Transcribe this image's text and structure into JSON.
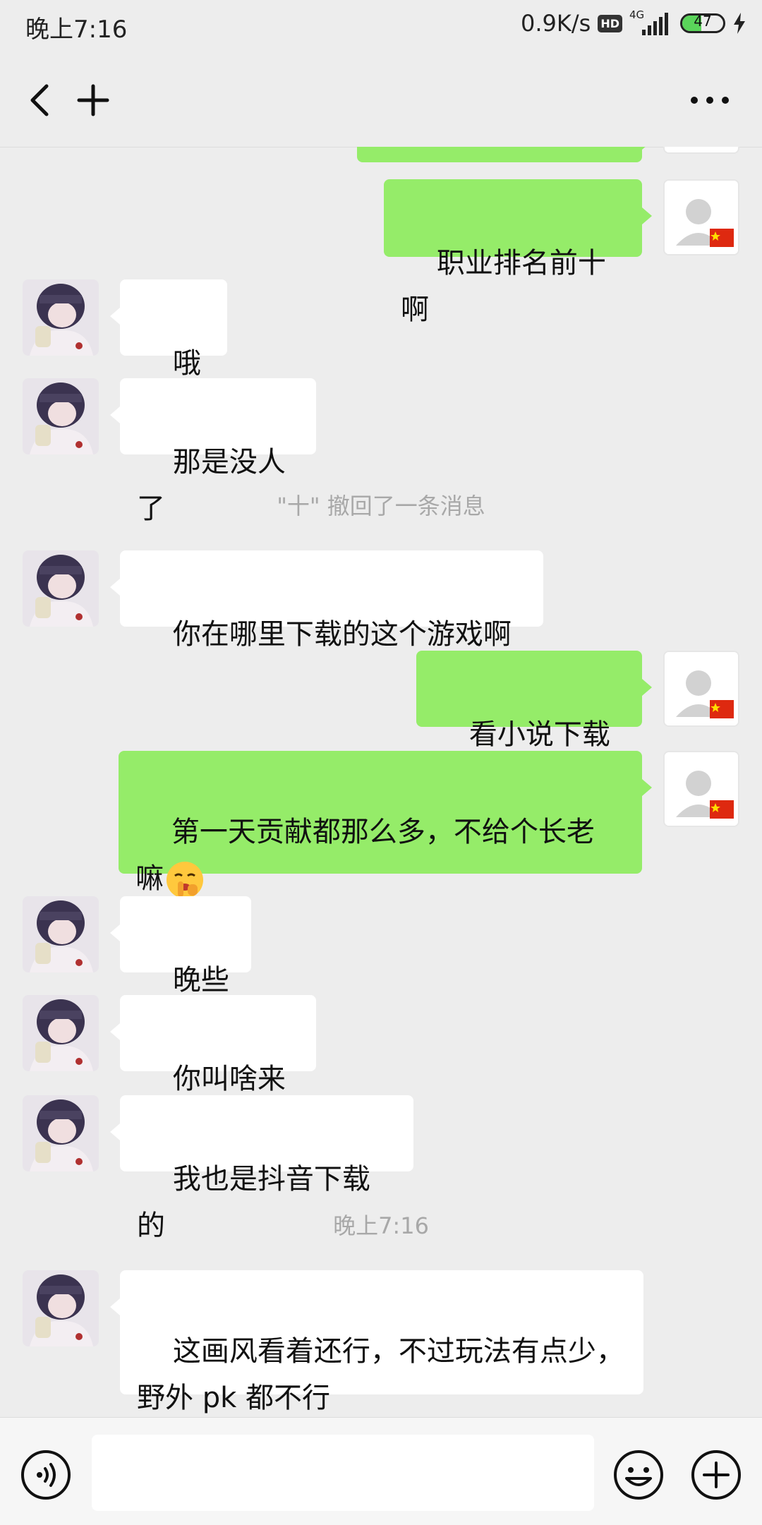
{
  "status_bar": {
    "time": "晚上7:16",
    "net_speed": "0.9K/s",
    "hd": "HD",
    "network": "4G",
    "battery_level": "47",
    "battery_percent": 47
  },
  "nav": {
    "back_icon": "chevron-left-icon",
    "add_icon": "plus-icon",
    "more_icon": "more-dots-icon"
  },
  "messages": [
    {
      "side": "out",
      "text": "职业排名前十啊"
    },
    {
      "side": "in",
      "text": "哦哦"
    },
    {
      "side": "in",
      "text": "那是没人了"
    },
    {
      "side": "system",
      "text": "\"十\" 撤回了一条消息"
    },
    {
      "side": "in",
      "text": "你在哪里下载的这个游戏啊"
    },
    {
      "side": "out",
      "text": "看小说下载的"
    },
    {
      "side": "out",
      "text": "第一天贡献都那么多，不给个长老\n嘛",
      "emoji": "shushing-face-emoji"
    },
    {
      "side": "in",
      "text": "晚些吧"
    },
    {
      "side": "in",
      "text": "你叫啥来着"
    },
    {
      "side": "in",
      "text": "我也是抖音下载的"
    },
    {
      "side": "system",
      "text": "晚上7:16"
    },
    {
      "side": "in",
      "text": "这画风看着还行，不过玩法有点少，\n野外 pk 都不行"
    }
  ],
  "input_bar": {
    "value": "",
    "voice_icon": "voice-icon",
    "emoji_icon": "emoji-icon",
    "plus_icon": "plus-circle-icon"
  },
  "colors": {
    "background": "#ededed",
    "outgoing_bubble": "#95ec69",
    "incoming_bubble": "#ffffff",
    "system_text": "#a8a8a8"
  }
}
